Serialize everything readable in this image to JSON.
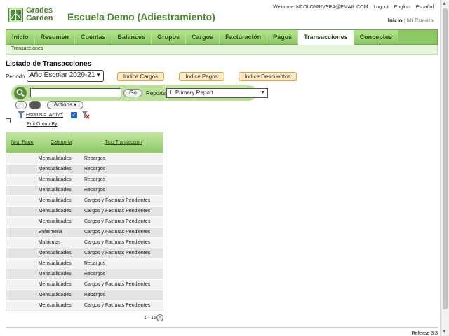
{
  "header": {
    "logo_line1": "Grades",
    "logo_line2": "Garden",
    "school_title": "Escuela Demo (Adiestramiento)",
    "welcome": "Welcome: NCOLONRIVERA@EMAIL.COM",
    "logout": "Logout",
    "english": "English",
    "espanol": "Español",
    "inicio": "Inicio",
    "mi_cuenta": "Mi Cuenta"
  },
  "nav": {
    "items": [
      "Inicio",
      "Resumen",
      "Cuentas",
      "Balances",
      "Grupos",
      "Cargos",
      "Facturación",
      "Pagos",
      "Transacciones",
      "Conceptos"
    ],
    "active": "Transacciones",
    "sub": "Transacciones"
  },
  "page": {
    "title": "Listado de Transacciones",
    "period_label": "Periodo",
    "period_value": "Año Escolar 2020-21",
    "btn_cargos": "Indice Cargos",
    "btn_pagos": "Indice Pagos",
    "btn_descuentos": "Indice Descuentos"
  },
  "search": {
    "go": "Go",
    "reports_label": "Reports",
    "report_selected": "1. Primary Report",
    "actions": "Actions"
  },
  "filter": {
    "text": "Estatus = 'Activo'",
    "edit_group": "Edit Group By"
  },
  "table": {
    "headers": [
      "Nro. Pago",
      "Categoría",
      "Tipo Transacción"
    ],
    "rows": [
      [
        "",
        "Mensualidades",
        "Recargos"
      ],
      [
        "",
        "Mensualidades",
        "Recargos"
      ],
      [
        "",
        "Mensualidades",
        "Recargos"
      ],
      [
        "",
        "Mensualidades",
        "Recargos"
      ],
      [
        "",
        "Mensualidades",
        "Cargos y Facturas Pendientes"
      ],
      [
        "",
        "Mensualidades",
        "Cargos y Facturas Pendientes"
      ],
      [
        "",
        "Mensualidades",
        "Cargos y Facturas Pendientes"
      ],
      [
        "",
        "Enfermeria",
        "Cargos y Facturas Pendientes"
      ],
      [
        "",
        "Matriculas",
        "Cargos y Facturas Pendientes"
      ],
      [
        "",
        "Mensualidades",
        "Cargos y Facturas Pendientes"
      ],
      [
        "",
        "Mensualidades",
        "Recargos"
      ],
      [
        "",
        "Mensualidades",
        "Recargos"
      ],
      [
        "",
        "Mensualidades",
        "Cargos y Facturas Pendientes"
      ],
      [
        "",
        "Mensualidades",
        "Recargos"
      ],
      [
        "",
        "Mensualidades",
        "Cargos y Facturas Pendientes"
      ]
    ]
  },
  "pager": {
    "range": "1 - 15"
  },
  "footer": {
    "release": "Release 3.3"
  },
  "colors": {
    "brand_green": "#4a8a2e",
    "nav_green": "#8cc966",
    "button_orange": "#fde9c3"
  }
}
